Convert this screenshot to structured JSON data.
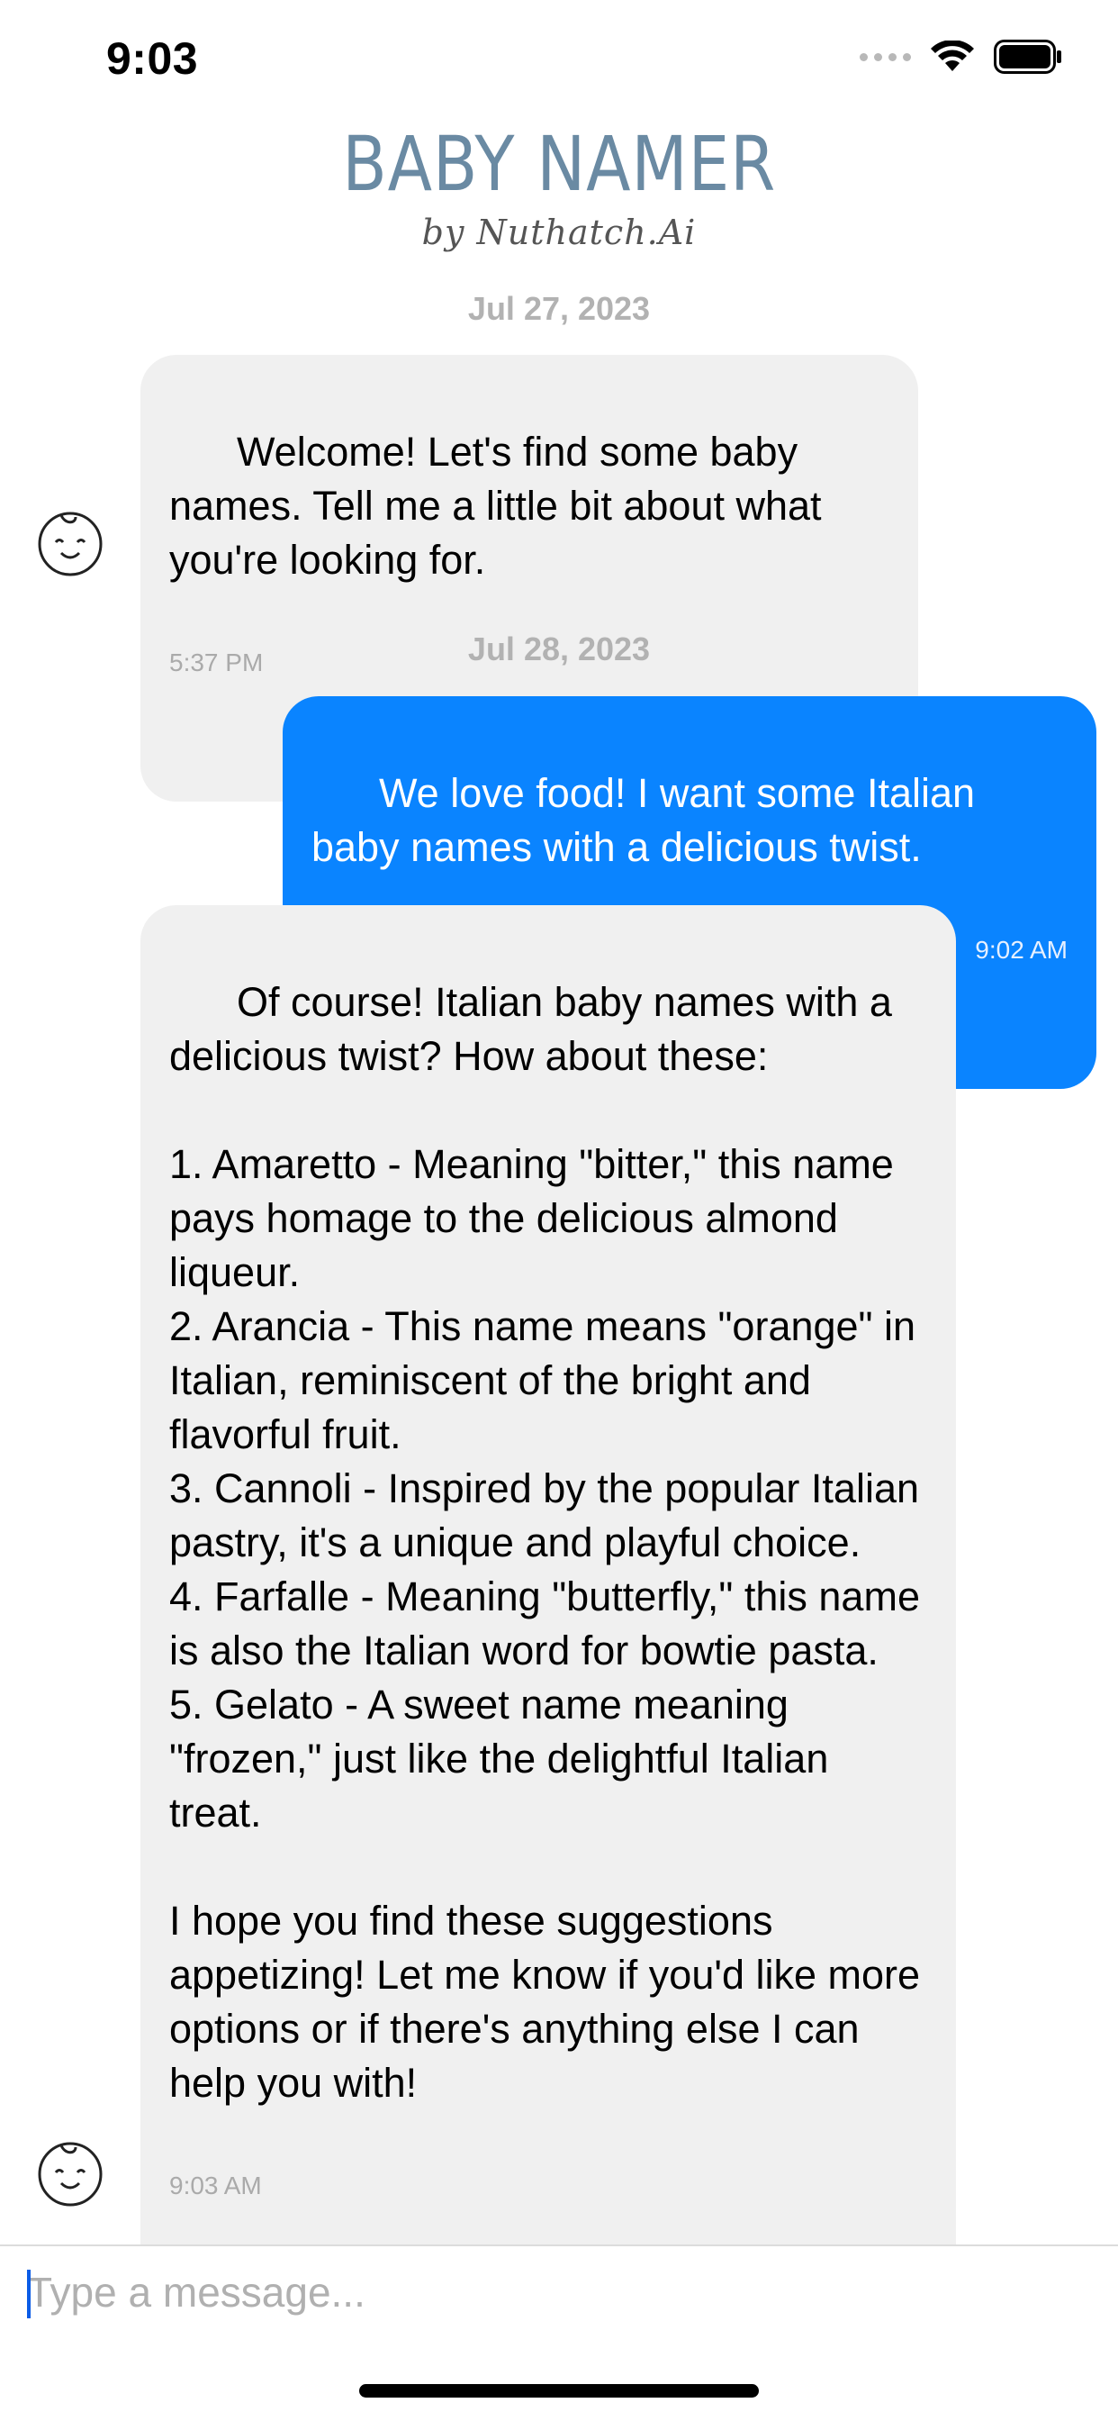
{
  "status_bar": {
    "time": "9:03"
  },
  "header": {
    "title": "BABY NAMER",
    "subtitle": "by Nuthatch.Ai"
  },
  "messages": [
    {
      "date": "Jul 27, 2023"
    },
    {
      "sender": "bot",
      "text": "Welcome! Let's find some baby names. Tell me a little bit about what you're looking for.",
      "time": "5:37 PM"
    },
    {
      "date": "Jul 28, 2023"
    },
    {
      "sender": "user",
      "text": "We love food! I want some Italian baby names with a delicious twist.",
      "time": "9:02 AM"
    },
    {
      "sender": "bot",
      "text": "Of course! Italian baby names with a delicious twist? How about these:\n\n1. Amaretto - Meaning \"bitter,\" this name pays homage to the delicious almond liqueur.\n2. Arancia - This name means \"orange\" in Italian, reminiscent of the bright and flavorful fruit.\n3. Cannoli - Inspired by the popular Italian pastry, it's a unique and playful choice.\n4. Farfalle - Meaning \"butterfly,\" this name is also the Italian word for bowtie pasta.\n5. Gelato - A sweet name meaning \"frozen,\" just like the delightful Italian treat.\n\nI hope you find these suggestions appetizing! Let me know if you'd like more options or if there's anything else I can help you with!",
      "time": "9:03 AM"
    }
  ],
  "composer": {
    "placeholder": "Type a message..."
  },
  "colors": {
    "outgoing_bubble": "#0a84ff",
    "incoming_bubble": "#f0f0f0",
    "date_text": "#b2b2b2",
    "logo": "#6a8aa3"
  },
  "icons": {
    "avatar": "baby-face-icon",
    "wifi": "wifi-icon",
    "battery": "battery-icon",
    "signal": "cellular-signal-icon"
  }
}
